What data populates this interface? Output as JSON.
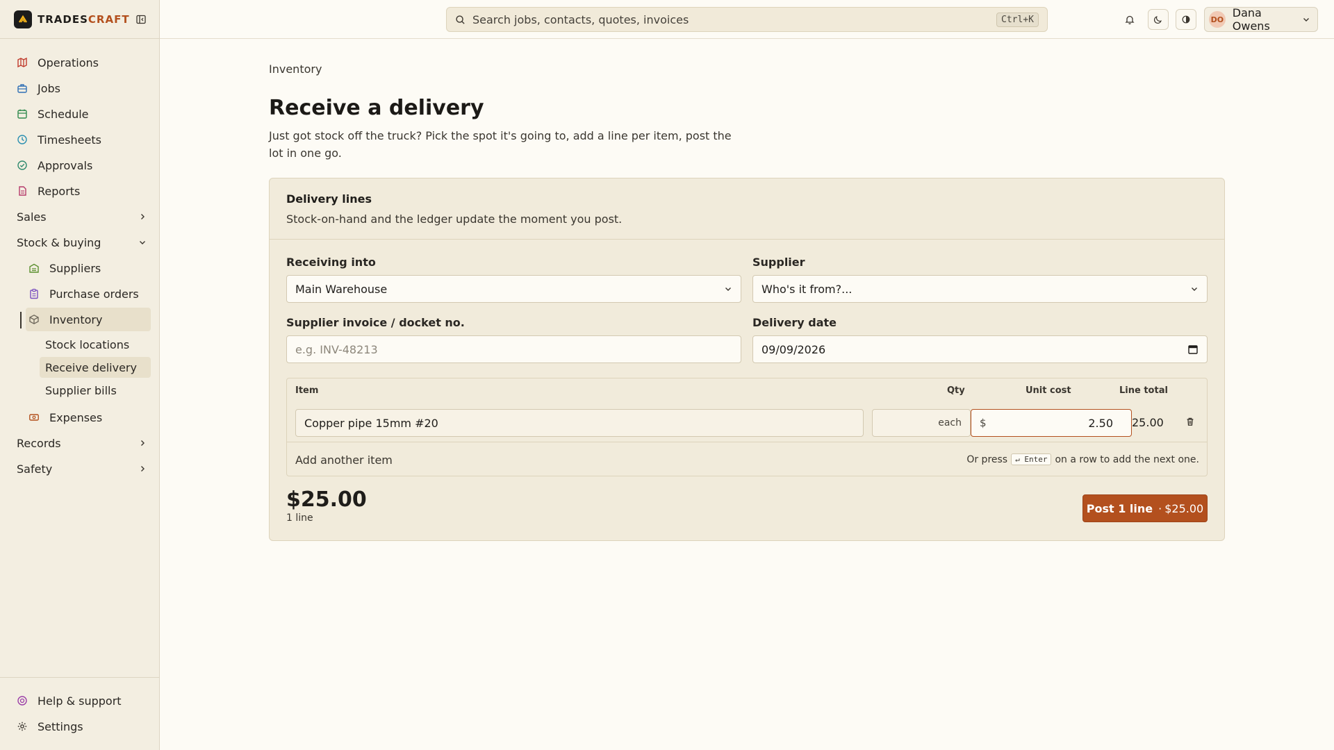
{
  "brand": {
    "name_part1": "TRADES",
    "name_part2": "CRAFT"
  },
  "sidebar": {
    "items": [
      {
        "label": "Operations",
        "icon": "map-icon",
        "color": "#c0392b"
      },
      {
        "label": "Jobs",
        "icon": "briefcase-icon",
        "color": "#2e6fb5"
      },
      {
        "label": "Schedule",
        "icon": "calendar-icon",
        "color": "#2f8a4d"
      },
      {
        "label": "Timesheets",
        "icon": "clock-icon",
        "color": "#2a8fb0"
      },
      {
        "label": "Approvals",
        "icon": "check-circle-icon",
        "color": "#2f8a6d"
      },
      {
        "label": "Reports",
        "icon": "file-icon",
        "color": "#b53a6a"
      }
    ],
    "groups": {
      "sales": "Sales",
      "stock": "Stock & buying",
      "records": "Records",
      "safety": "Safety"
    },
    "stock_items": [
      {
        "label": "Suppliers",
        "icon": "warehouse-icon",
        "color": "#5b8f2e"
      },
      {
        "label": "Purchase orders",
        "icon": "clipboard-icon",
        "color": "#7a4fc0"
      },
      {
        "label": "Inventory",
        "icon": "box-icon",
        "color": "#6b6559"
      }
    ],
    "inventory_sub": [
      "Stock locations",
      "Receive delivery",
      "Supplier bills"
    ],
    "expenses": {
      "label": "Expenses",
      "icon": "receipt-icon",
      "color": "#b3501e"
    },
    "bottom": {
      "help": "Help & support",
      "settings": "Settings"
    }
  },
  "topbar": {
    "search_placeholder": "Search jobs, contacts, quotes, invoices",
    "search_shortcut": "Ctrl+K",
    "user_initials": "DO",
    "user_name": "Dana Owens"
  },
  "page": {
    "breadcrumb": "Inventory",
    "title": "Receive a delivery",
    "subtitle": "Just got stock off the truck? Pick the spot it's going to, add a line per item, post the lot in one go."
  },
  "card": {
    "title": "Delivery lines",
    "description": "Stock-on-hand and the ledger update the moment you post.",
    "fields": {
      "receiving_label": "Receiving into",
      "receiving_value": "Main Warehouse",
      "supplier_label": "Supplier",
      "supplier_placeholder": "Who's it from?...",
      "invoice_label": "Supplier invoice / docket no.",
      "invoice_placeholder": "e.g. INV-48213",
      "date_label": "Delivery date",
      "date_value": "09/09/2026"
    },
    "lines": {
      "headers": {
        "item": "Item",
        "qty": "Qty",
        "unit_cost": "Unit cost",
        "line_total": "Line total"
      },
      "rows": [
        {
          "item": "Copper pipe 15mm #20",
          "qty_unit": "each",
          "currency": "$",
          "unit_cost": "2.50",
          "line_total": "25.00"
        }
      ],
      "add_label": "Add another item",
      "hint_prefix": "Or press",
      "hint_key": "↵ Enter",
      "hint_suffix": "on a row to add the next one."
    },
    "total": "$25.00",
    "line_count": "1 line",
    "post_button": {
      "label": "Post 1 line",
      "separator": "·",
      "amount": "$25.00"
    }
  },
  "colors": {
    "accent": "#b3501e",
    "background": "#fdfbf5",
    "sidebar": "#f3eee1",
    "card": "#f1ebdb"
  }
}
